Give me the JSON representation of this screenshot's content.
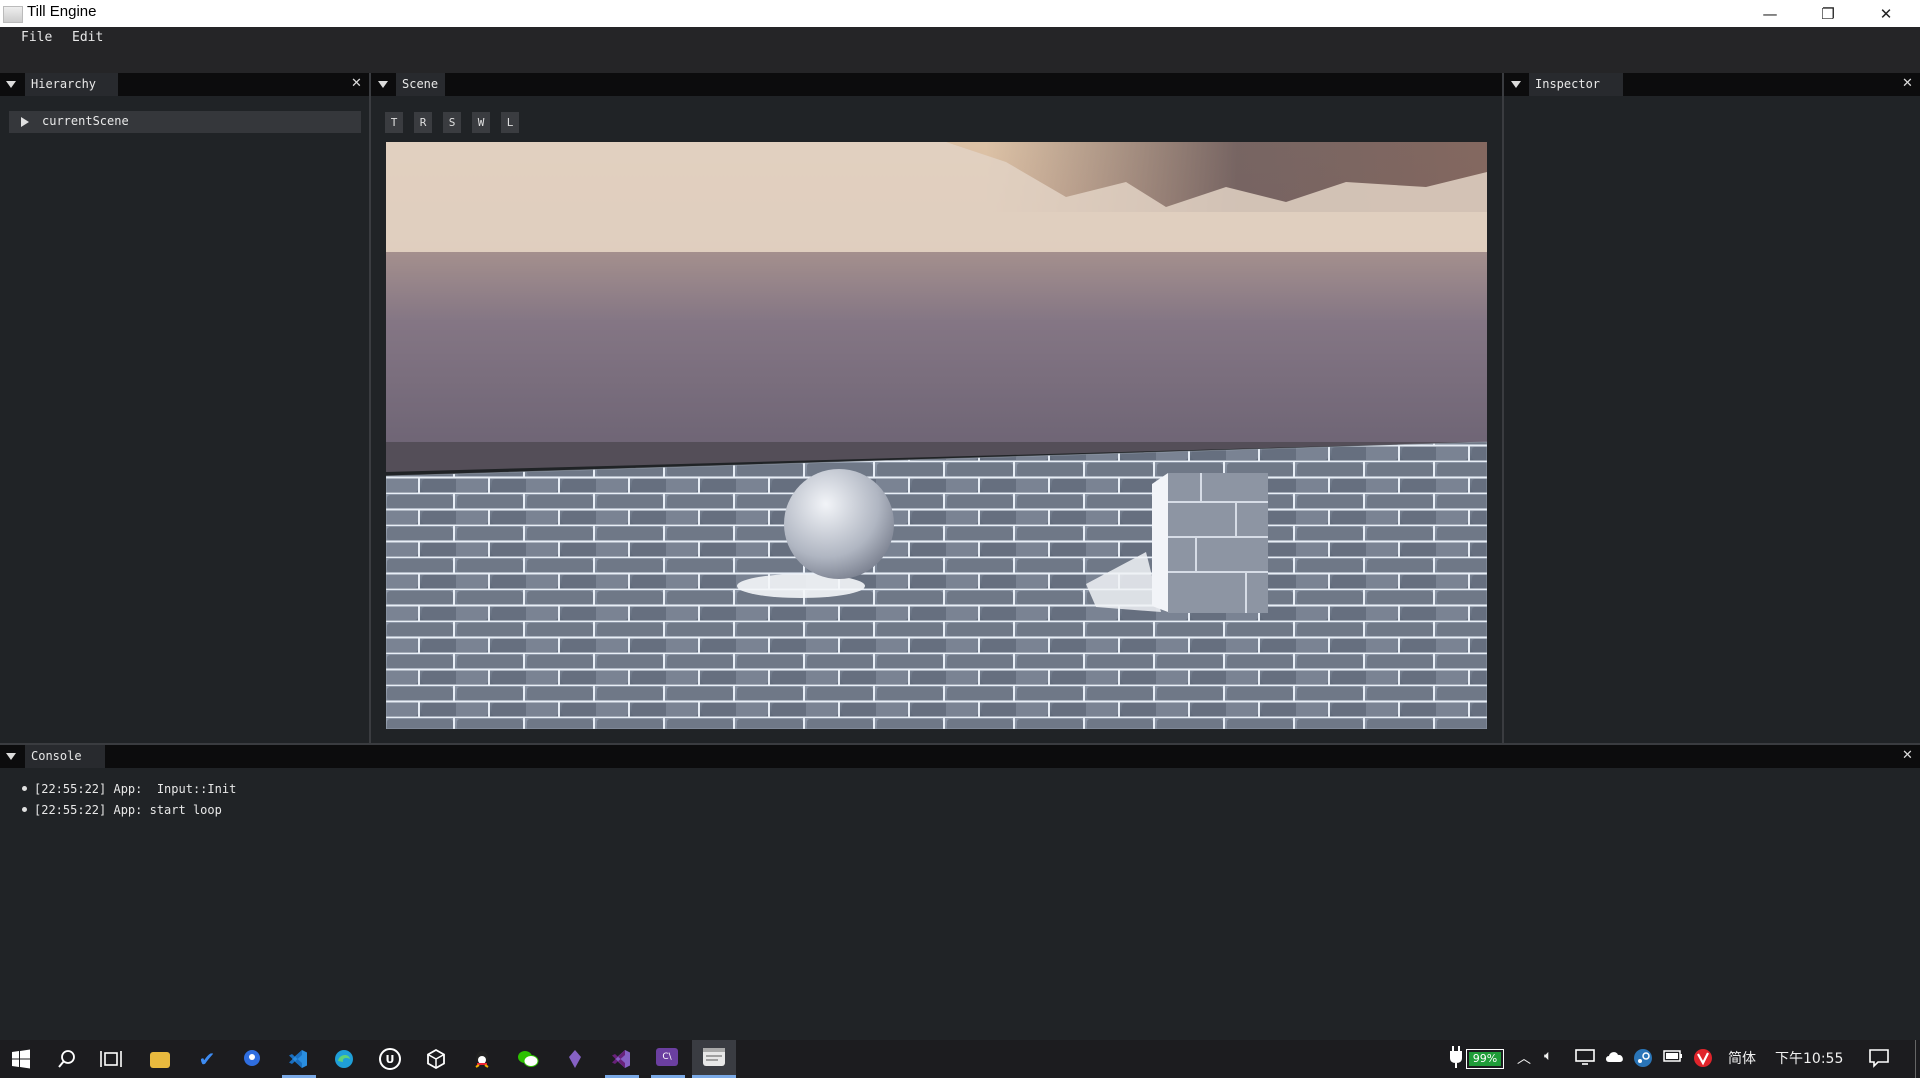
{
  "window": {
    "title": "Till Engine"
  },
  "menu": {
    "items": [
      "File",
      "Edit"
    ]
  },
  "hierarchy": {
    "title": "Hierarchy",
    "items": [
      "currentScene"
    ]
  },
  "scene": {
    "title": "Scene",
    "tools": [
      "T",
      "R",
      "S",
      "W",
      "L"
    ]
  },
  "inspector": {
    "title": "Inspector"
  },
  "console": {
    "title": "Console",
    "lines": [
      "[22:55:22] App:  Input::Init",
      "[22:55:22] App: start loop"
    ]
  },
  "taskbar": {
    "apps": [
      "start-icon",
      "search-icon",
      "task-view-icon",
      "file-explorer-icon",
      "todo-icon",
      "maps-icon",
      "vscode-icon",
      "edge-icon",
      "unreal-engine-icon",
      "unity-icon",
      "qq-icon",
      "wechat-icon",
      "visual-studio-preview-icon",
      "visual-studio-icon",
      "clion-icon",
      "till-engine-icon"
    ],
    "battery": "99%",
    "ime": "简体",
    "clock": "下午10:55"
  },
  "colors": {
    "panel_bg": "#202326",
    "header_bg": "#0c0c0d",
    "tab_bg": "#282a2e",
    "accent": "#7aa9e6"
  }
}
